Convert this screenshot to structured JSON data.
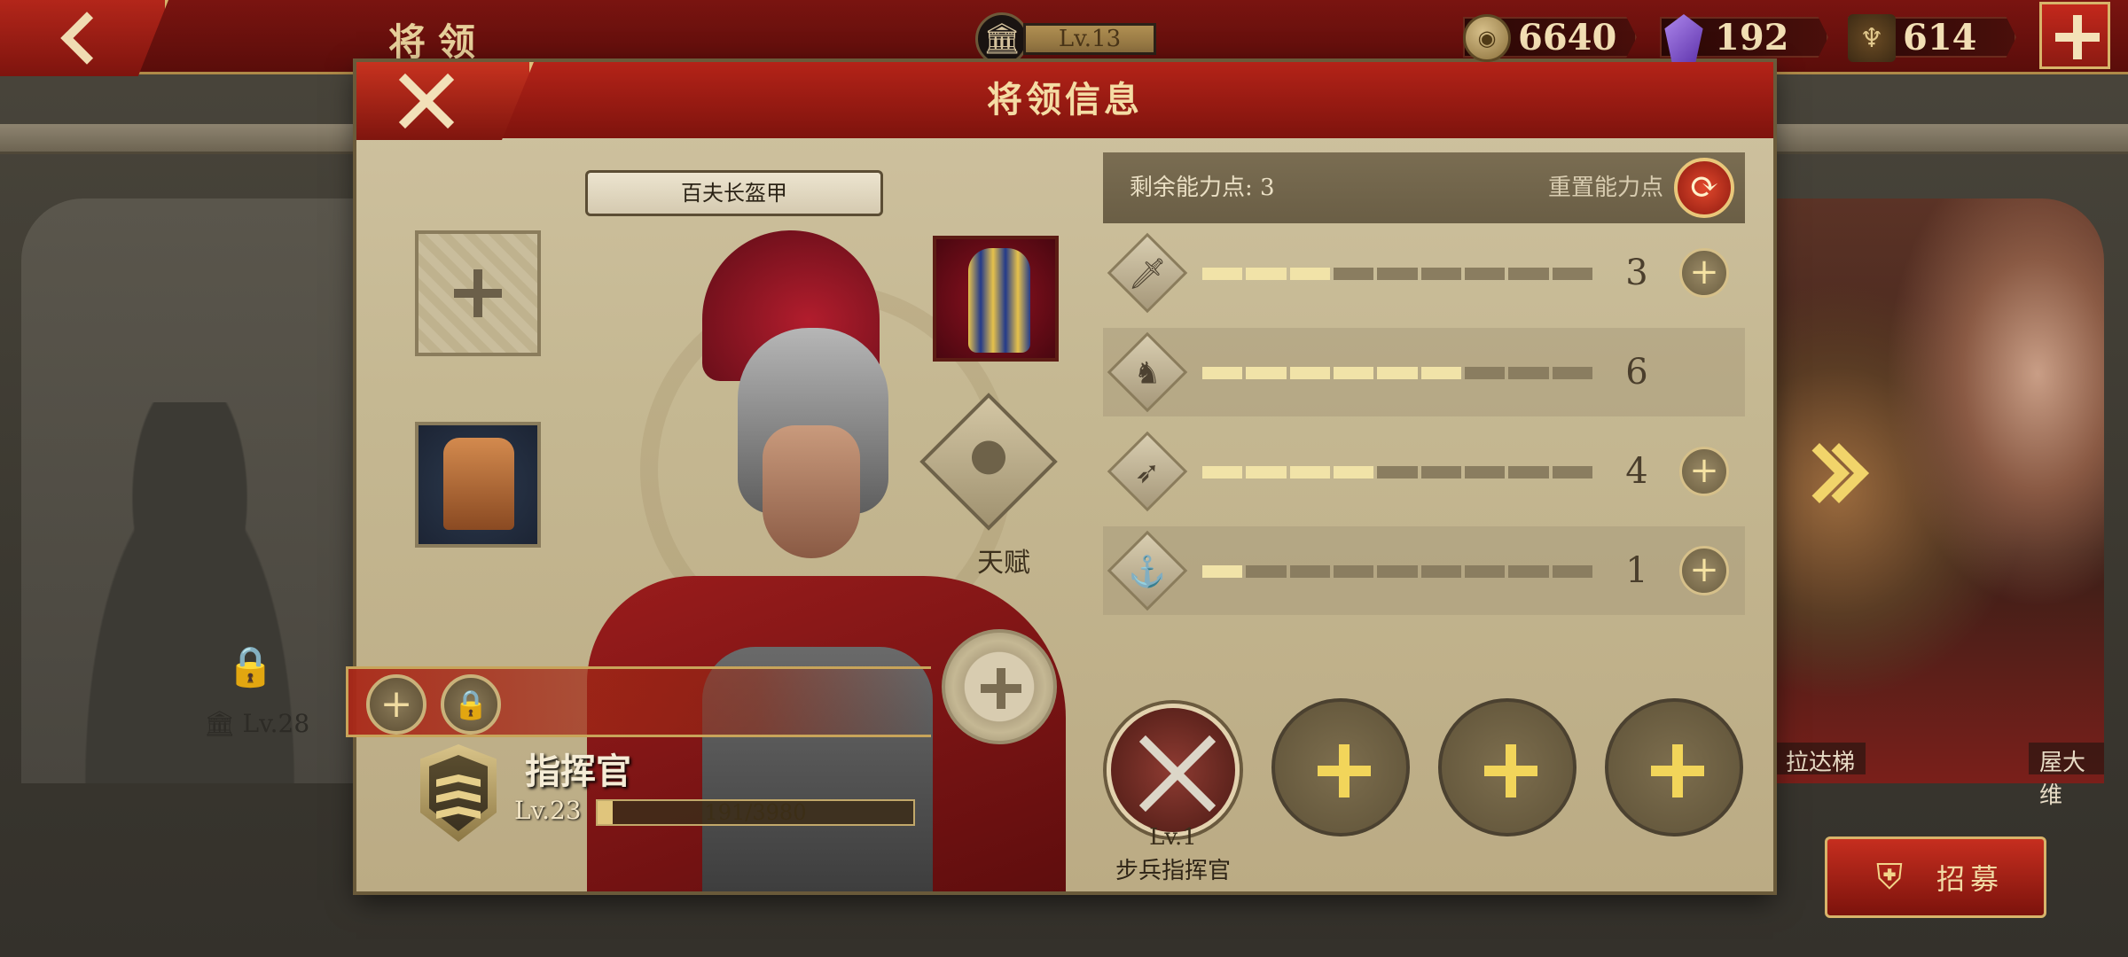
{
  "topbar": {
    "title": "将领",
    "level": "Lv.13",
    "resources": [
      {
        "icon": "coin-icon",
        "value": "6640"
      },
      {
        "icon": "gem-icon",
        "value": "192"
      },
      {
        "icon": "spqr-eagle-icon",
        "value": "614"
      }
    ]
  },
  "roster": {
    "locked_level": "Lv.28",
    "right_names": [
      "拉达梯",
      "屋大维"
    ],
    "recruit_label": "招募"
  },
  "modal": {
    "title": "将领信息",
    "armor_label": "百夫长盔甲",
    "talent_label": "天赋",
    "commander": {
      "title": "指挥官",
      "level": "Lv.23",
      "xp_text": "191/3980",
      "xp_fraction": 0.048
    },
    "points": {
      "remaining_label": "剩余能力点: 3",
      "reset_label": "重置能力点"
    },
    "stats": [
      {
        "icon": "sword-icon",
        "value": "3",
        "filled": 3,
        "total": 9,
        "has_plus": true
      },
      {
        "icon": "horse-icon",
        "value": "6",
        "filled": 6,
        "total": 9,
        "has_plus": false
      },
      {
        "icon": "bow-icon",
        "value": "4",
        "filled": 4,
        "total": 9,
        "has_plus": true
      },
      {
        "icon": "anchor-icon",
        "value": "1",
        "filled": 1,
        "total": 9,
        "has_plus": true
      }
    ],
    "skill": {
      "level": "Lv.1",
      "name": "步兵指挥官"
    }
  },
  "colors": {
    "header_red": "#b42318",
    "gold": "#e0c57c",
    "panel_beige": "#c5b892"
  }
}
